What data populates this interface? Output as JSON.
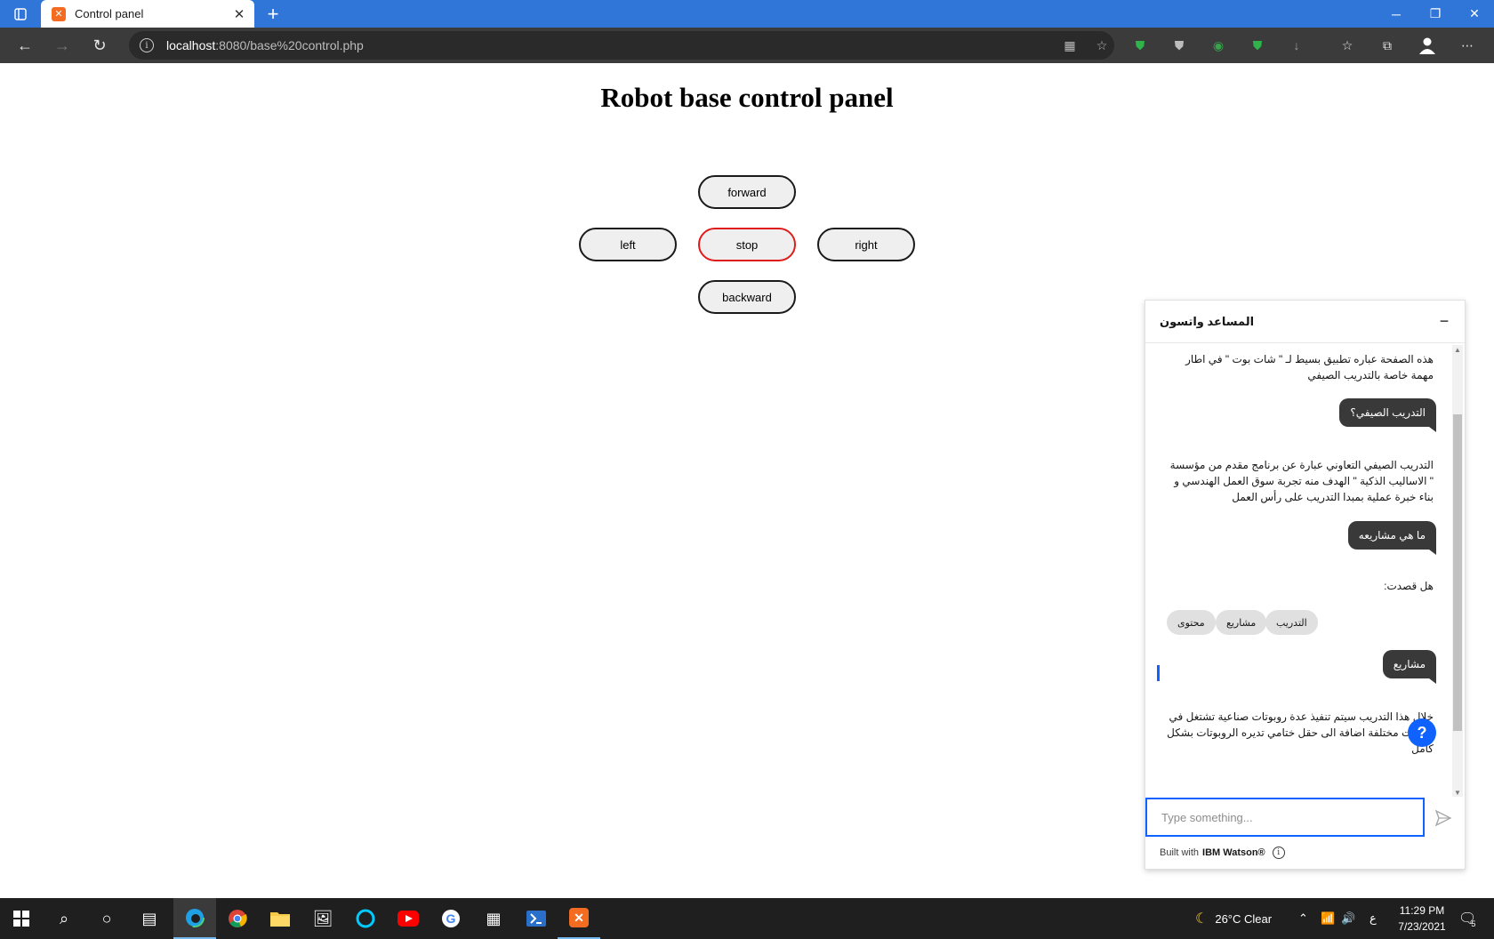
{
  "browser": {
    "tab_title": "Control panel",
    "url_host": "localhost",
    "url_rest": ":8080/base%20control.php",
    "colors": {
      "titlebar": "#3075d8",
      "toolbar": "#3b3b3b"
    }
  },
  "page": {
    "title": "Robot base control panel",
    "buttons": {
      "forward": "forward",
      "left": "left",
      "stop": "stop",
      "right": "right",
      "backward": "backward"
    },
    "colors": {
      "stop_border": "#e01b1b"
    }
  },
  "chat": {
    "title": "المساعد واتسون",
    "messages": {
      "bot_intro": "هذه الصفحة عباره تطبيق بسيط لـ \" شات بوت \" في اطار مهمة خاصة بالتدريب الصيفي",
      "user_q1": "التدريب الصيفي؟",
      "bot_a1": "التدريب الصيفي التعاوني عبارة عن برنامج مقدم من مؤسسة \" الاساليب الذكية \" الهدف منه تجربة سوق العمل الهندسي و بناء خبرة عملية بمبدا التدريب على رأس العمل",
      "user_q2": "ما هي مشاريعه",
      "bot_did_you_mean": "هل قصدت:",
      "user_q3": "مشاريع",
      "bot_a3": "خلال هذا التدريب سيتم تنفيذ عدة روبوتات صناعية تشتغل في مجالات مختلفة اضافة الى حقل ختامي تديره الروبوتات بشكل كامل"
    },
    "chips": [
      "التدريب",
      "مشاريع",
      "محتوى"
    ],
    "input_placeholder": "Type something...",
    "footer_text": "Built with",
    "footer_brand": "IBM Watson®",
    "colors": {
      "accent": "#0f62fe",
      "user_bubble": "#393939"
    }
  },
  "taskbar": {
    "weather": "26°C  Clear",
    "lang": "ع",
    "time": "11:29 PM",
    "date": "7/23/2021",
    "notifications": "5"
  }
}
